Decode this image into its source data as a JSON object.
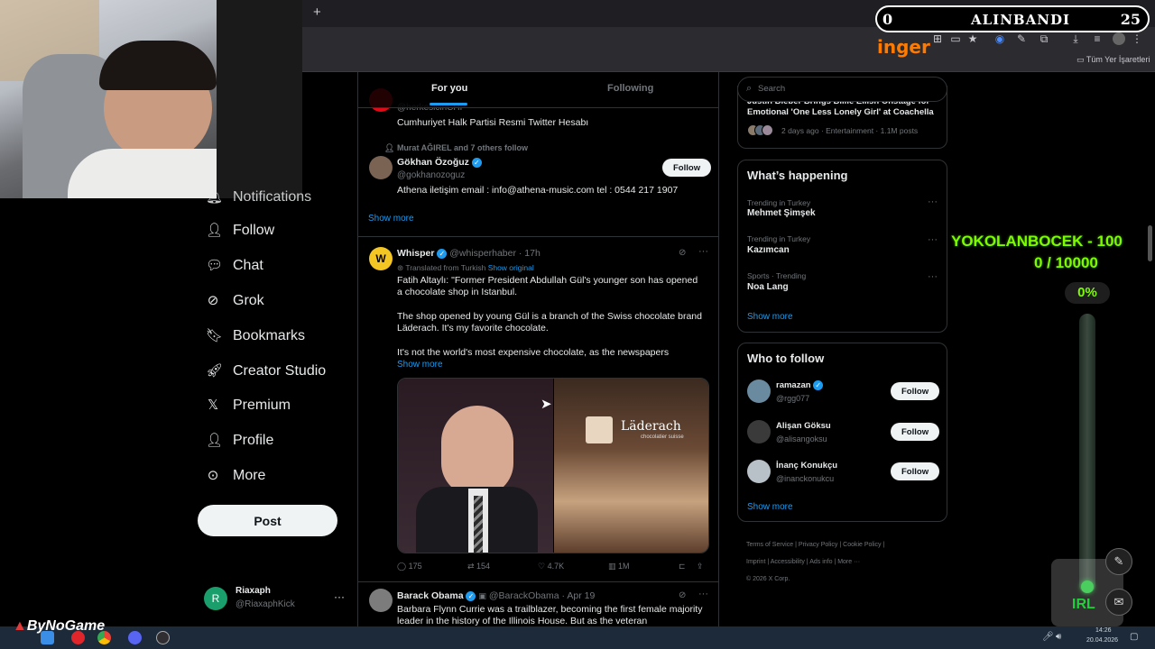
{
  "browser": {
    "new_tab_label": "+",
    "bookmarks_folder": "Tüm Yer İşaretleri"
  },
  "stream_overlay": {
    "bar_left": "0",
    "bar_title": "ALINBANDI",
    "bar_right": "25",
    "inger": "inger",
    "yokolan_title": "YOKOLANBOCEK - 100",
    "yokolan_progress": "0 / 10000",
    "yokolan_percent": "0%",
    "irl": "IRL",
    "watermark": "ByNoGame"
  },
  "nav": {
    "notifications": "Notifications",
    "follow": "Follow",
    "chat": "Chat",
    "grok": "Grok",
    "bookmarks": "Bookmarks",
    "creator_studio": "Creator Studio",
    "premium": "Premium",
    "profile": "Profile",
    "more": "More",
    "post": "Post"
  },
  "account": {
    "initial": "R",
    "name": "Riaxaph",
    "handle": "@RiaxaphKick"
  },
  "tabs": {
    "for_you": "For you",
    "following": "Following"
  },
  "suggestions": [
    {
      "handle": "@herkesicinCHP",
      "bio": "Cumhuriyet Halk Partisi Resmi Twitter Hesabı"
    },
    {
      "context": "Murat AĞIREL and 7 others follow",
      "name": "Gökhan Özoğuz",
      "handle": "@gokhanozoguz",
      "bio": "Athena iletişim email : info@athena-music.com tel : 0544 217 1907",
      "follow": "Follow"
    }
  ],
  "show_more": "Show more",
  "tweet": {
    "name": "Whisper",
    "handle": "@whisperhaber",
    "time": "· 17h",
    "translated": "Translated from Turkish",
    "show_original": "Show original",
    "p1": "Fatih Altaylı: \"Former President Abdullah Gül's younger son has opened a chocolate shop in Istanbul.",
    "p2": "The shop opened by young Gül is a branch of the Swiss chocolate brand Läderach. It's my favorite chocolate.",
    "p3": "It's not the world's most expensive chocolate, as the newspapers",
    "show_more": "Show more",
    "shop_sign": "Läderach",
    "shop_sub": "chocolatier suisse",
    "replies": "175",
    "reposts": "154",
    "likes": "4.7K",
    "views": "1M"
  },
  "tweet2": {
    "name": "Barack Obama",
    "handle": "@BarackObama",
    "time": "· Apr 19",
    "text": "Barbara Flynn Currie was a trailblazer, becoming the first female majority leader in the history of the Illinois House. But as the veteran representative"
  },
  "search": {
    "placeholder": "Search"
  },
  "news": {
    "headline": "Justin Bieber Brings Billie Eilish Onstage for Emotional 'One Less Lonely Girl' at Coachella",
    "meta": "2 days ago · Entertainment · 1.1M posts"
  },
  "happening": {
    "title": "What’s happening",
    "trends": [
      {
        "category": "Trending in Turkey",
        "name": "Mehmet Şimşek"
      },
      {
        "category": "Trending in Turkey",
        "name": "Kazımcan"
      },
      {
        "category": "Sports · Trending",
        "name": "Noa Lang"
      }
    ],
    "show_more": "Show more"
  },
  "who_to_follow": {
    "title": "Who to follow",
    "users": [
      {
        "name": "ramazan",
        "handle": "@rgg077",
        "follow": "Follow"
      },
      {
        "name": "Alişan Göksu",
        "handle": "@alisangoksu",
        "follow": "Follow"
      },
      {
        "name": "İnanç Konukçu",
        "handle": "@inanckonukcu",
        "follow": "Follow"
      }
    ],
    "show_more": "Show more"
  },
  "footer": {
    "terms": "Terms of Service",
    "privacy": "Privacy Policy",
    "cookie": "Cookie Policy",
    "imprint": "Imprint",
    "accessibility": "Accessibility",
    "ads": "Ads info",
    "more": "More ···",
    "copyright": "© 2026 X Corp."
  },
  "taskbar": {
    "time": "14:26",
    "date": "20.04.2026"
  },
  "colors": {
    "accent": "#1d9bf0",
    "overlay_green": "#7CFC00",
    "overlay_orange": "#ff7a00"
  }
}
